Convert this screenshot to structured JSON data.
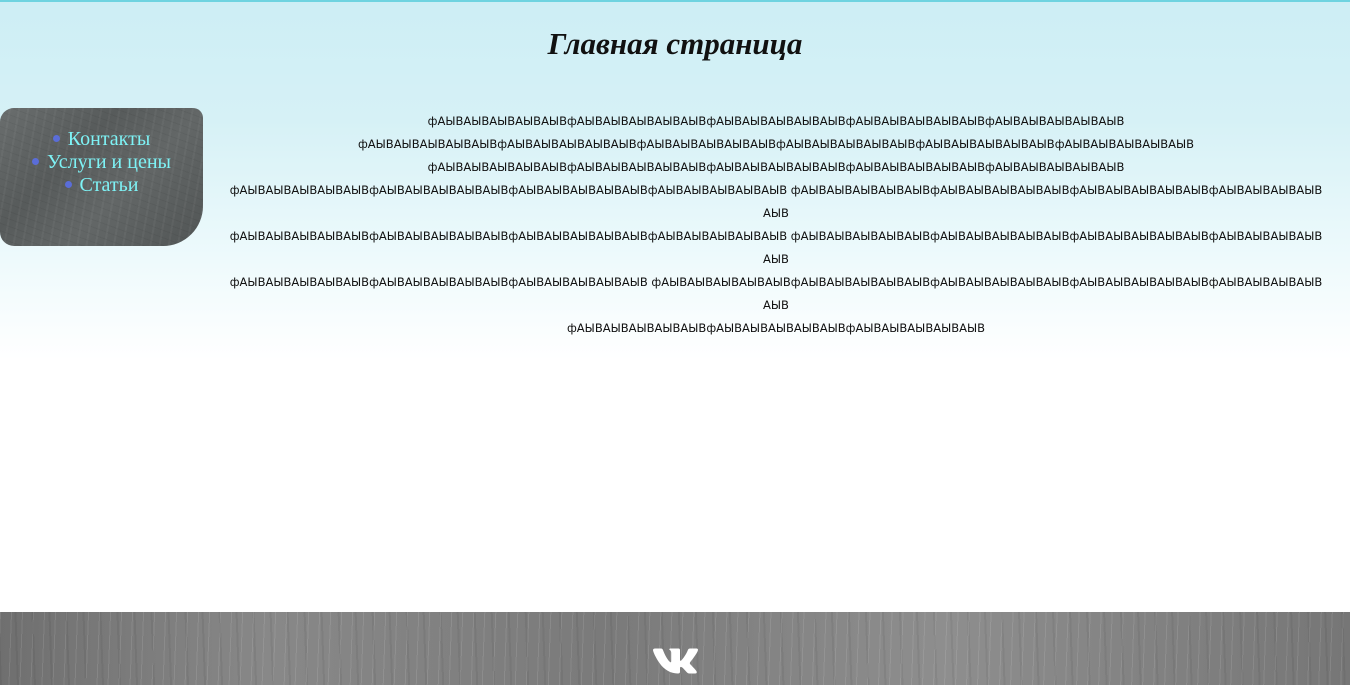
{
  "header": {
    "title": "Главная страница"
  },
  "sidebar": {
    "items": [
      {
        "label": "Контакты"
      },
      {
        "label": "Услуги и цены"
      },
      {
        "label": "Статьи"
      }
    ]
  },
  "main": {
    "paragraphs": [
      "фАЫВАЫВАЫВАЫВАЫВфАЫВАЫВАЫВАЫВАЫВфАЫВАЫВАЫВАЫВАЫВфАЫВАЫВАЫВАЫВАЫВфАЫВАЫВАЫВАЫВАЫВ",
      "фАЫВАЫВАЫВАЫВАЫВфАЫВАЫВАЫВАЫВАЫВфАЫВАЫВАЫВАЫВАЫВфАЫВАЫВАЫВАЫВАЫВфАЫВАЫВАЫВАЫВАЫВфАЫВАЫВАЫВАЫВАЫВ",
      "фАЫВАЫВАЫВАЫВАЫВфАЫВАЫВАЫВАЫВАЫВфАЫВАЫВАЫВАЫВАЫВфАЫВАЫВАЫВАЫВАЫВфАЫВАЫВАЫВАЫВАЫВ",
      "фАЫВАЫВАЫВАЫВАЫВфАЫВАЫВАЫВАЫВАЫВфАЫВАЫВАЫВАЫВАЫВфАЫВАЫВАЫВАЫВАЫВ фАЫВАЫВАЫВАЫВАЫВфАЫВАЫВАЫВАЫВАЫВфАЫВАЫВАЫВАЫВАЫВфАЫВАЫВАЫВАЫВАЫВ",
      "фАЫВАЫВАЫВАЫВАЫВфАЫВАЫВАЫВАЫВАЫВфАЫВАЫВАЫВАЫВАЫВфАЫВАЫВАЫВАЫВАЫВ фАЫВАЫВАЫВАЫВАЫВфАЫВАЫВАЫВАЫВАЫВфАЫВАЫВАЫВАЫВАЫВфАЫВАЫВАЫВАЫВАЫВ",
      "фАЫВАЫВАЫВАЫВАЫВфАЫВАЫВАЫВАЫВАЫВфАЫВАЫВАЫВАЫВАЫВ фАЫВАЫВАЫВАЫВАЫВфАЫВАЫВАЫВАЫВАЫВфАЫВАЫВАЫВАЫВАЫВфАЫВАЫВАЫВАЫВАЫВфАЫВАЫВАЫВАЫВАЫВ",
      "фАЫВАЫВАЫВАЫВАЫВфАЫВАЫВАЫВАЫВАЫВфАЫВАЫВАЫВАЫВАЫВ"
    ]
  },
  "footer": {
    "social_icon": "vk-icon"
  },
  "colors": {
    "nav_link": "#7ef3f6",
    "nav_bullet": "#5a6dd8",
    "sidebar_bg": "#5f6363",
    "footer_bg": "#7f7f7f",
    "header_bg": "#cdeef5"
  }
}
